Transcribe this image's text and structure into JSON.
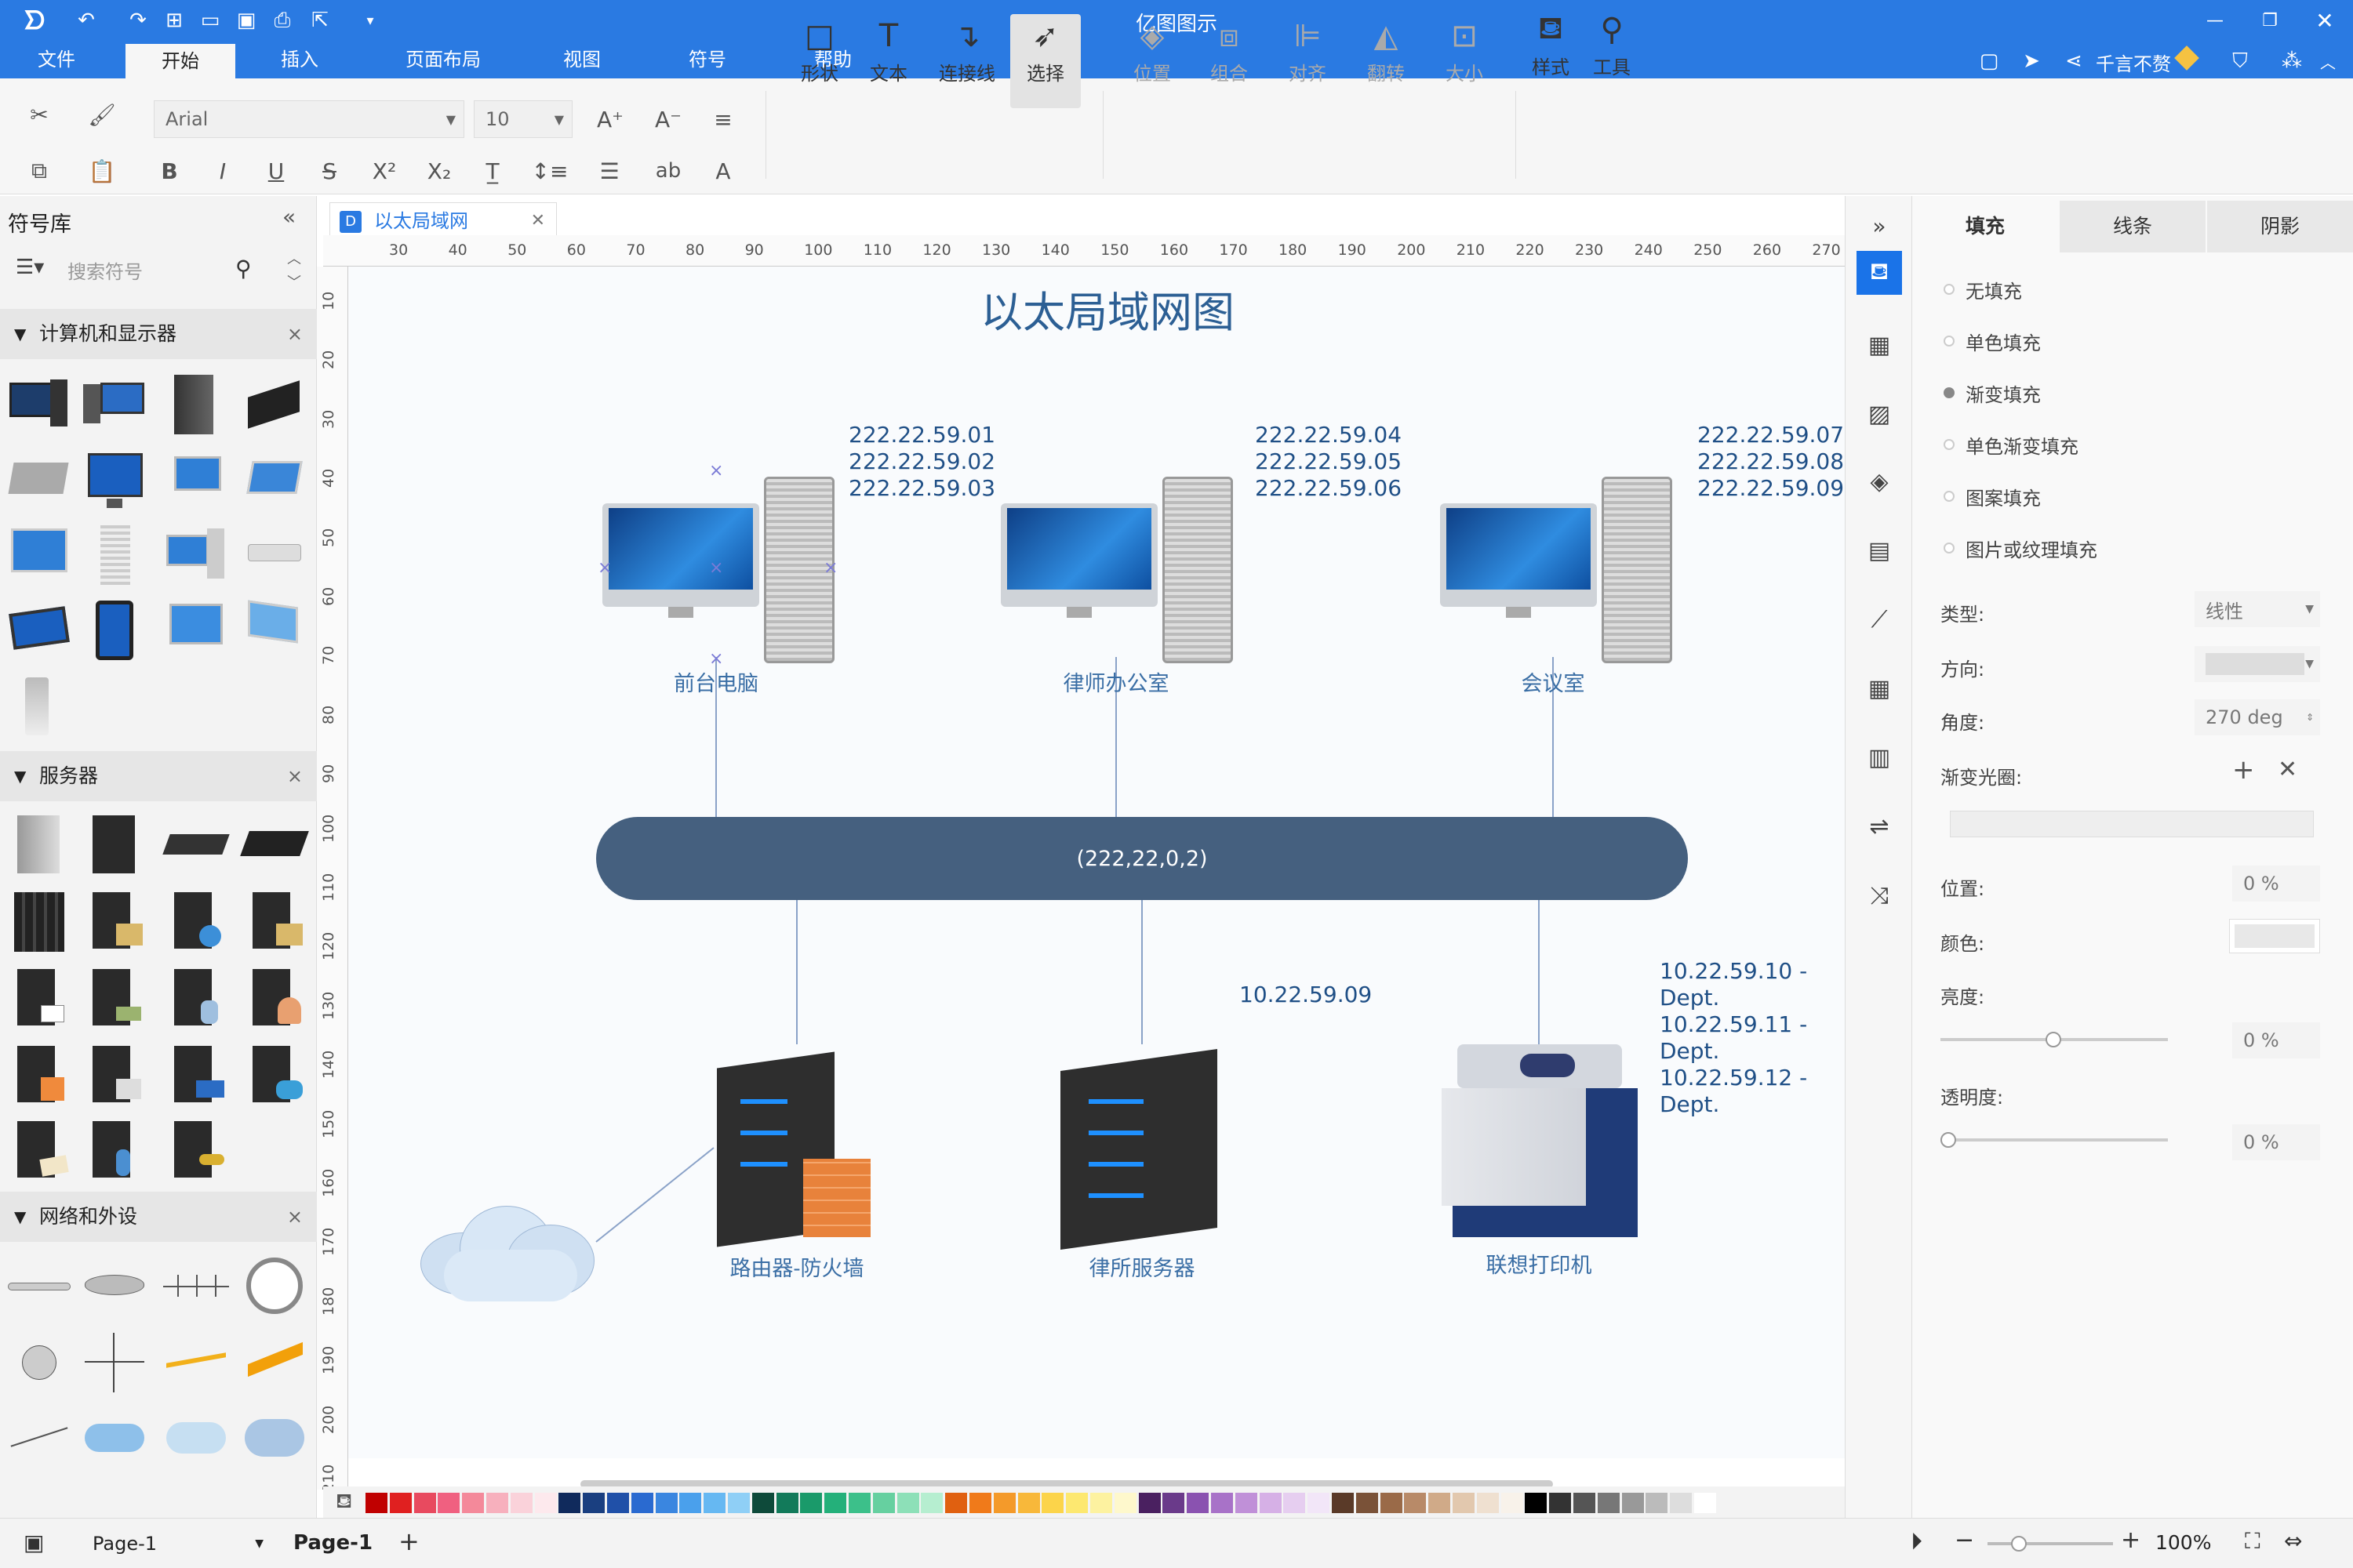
{
  "app": {
    "title": "亿图图示"
  },
  "user": {
    "name": "千言不赘"
  },
  "menu": {
    "tabs": [
      "文件",
      "开始",
      "插入",
      "页面布局",
      "视图",
      "符号",
      "帮助"
    ],
    "active": "开始"
  },
  "ribbon": {
    "font_name": "Arial",
    "font_size": "10",
    "big_buttons": [
      "形状",
      "文本",
      "连接线",
      "选择",
      "位置",
      "组合",
      "对齐",
      "翻转",
      "大小",
      "样式",
      "工具"
    ]
  },
  "symbol_library": {
    "title": "符号库",
    "search_placeholder": "搜索符号",
    "categories": [
      "计算机和显示器",
      "服务器",
      "网络和外设"
    ]
  },
  "document": {
    "tab_title": "以太局域网"
  },
  "ruler": {
    "h_ticks": [
      "30",
      "40",
      "50",
      "60",
      "70",
      "80",
      "90",
      "100",
      "110",
      "120",
      "130",
      "140",
      "150",
      "160",
      "170",
      "180",
      "190",
      "200",
      "210",
      "220",
      "230",
      "240",
      "250",
      "260",
      "270"
    ],
    "v_ticks": [
      "10",
      "20",
      "30",
      "40",
      "50",
      "60",
      "70",
      "80",
      "90",
      "100",
      "110",
      "120",
      "130",
      "140",
      "150",
      "160",
      "170",
      "180",
      "190",
      "200",
      "210"
    ]
  },
  "diagram": {
    "title": "以太局域网图",
    "bus_label": "(222,22,0,2)",
    "nodes": {
      "front_desk": {
        "label": "前台电脑",
        "ips": [
          "222.22.59.01",
          "222.22.59.02",
          "222.22.59.03"
        ]
      },
      "lawyer_office": {
        "label": "律师办公室",
        "ips": [
          "222.22.59.04",
          "222.22.59.05",
          "222.22.59.06"
        ]
      },
      "meeting_room": {
        "label": "会议室",
        "ips": [
          "222.22.59.07",
          "222.22.59.08",
          "222.22.59.09"
        ]
      },
      "router": {
        "label": "路由器-防火墙"
      },
      "server": {
        "label": "律所服务器",
        "ip": "10.22.59.09"
      },
      "printer": {
        "label": "联想打印机",
        "ips": [
          "10.22.59.10 - Dept.",
          "10.22.59.11 - Dept.",
          "10.22.59.12 - Dept."
        ]
      }
    }
  },
  "right_panel": {
    "tabs": [
      "填充",
      "线条",
      "阴影"
    ],
    "active_tab": "填充",
    "fill_options": [
      "无填充",
      "单色填充",
      "渐变填充",
      "单色渐变填充",
      "图案填充",
      "图片或纹理填充"
    ],
    "selected_fill": "渐变填充",
    "type_label": "类型:",
    "type_value": "线性",
    "direction_label": "方向:",
    "angle_label": "角度:",
    "angle_value": "270 deg",
    "stops_label": "渐变光圈:",
    "position_label": "位置:",
    "position_value": "0 %",
    "color_label": "颜色:",
    "brightness_label": "亮度:",
    "brightness_value": "0 %",
    "transparency_label": "透明度:",
    "transparency_value": "0 %"
  },
  "status": {
    "page_selector": "Page-1",
    "page_tab": "Page-1",
    "zoom": "100%"
  },
  "colors": {
    "accent": "#2a7ae2",
    "bus": "#45607f",
    "label": "#3a6ea5"
  }
}
